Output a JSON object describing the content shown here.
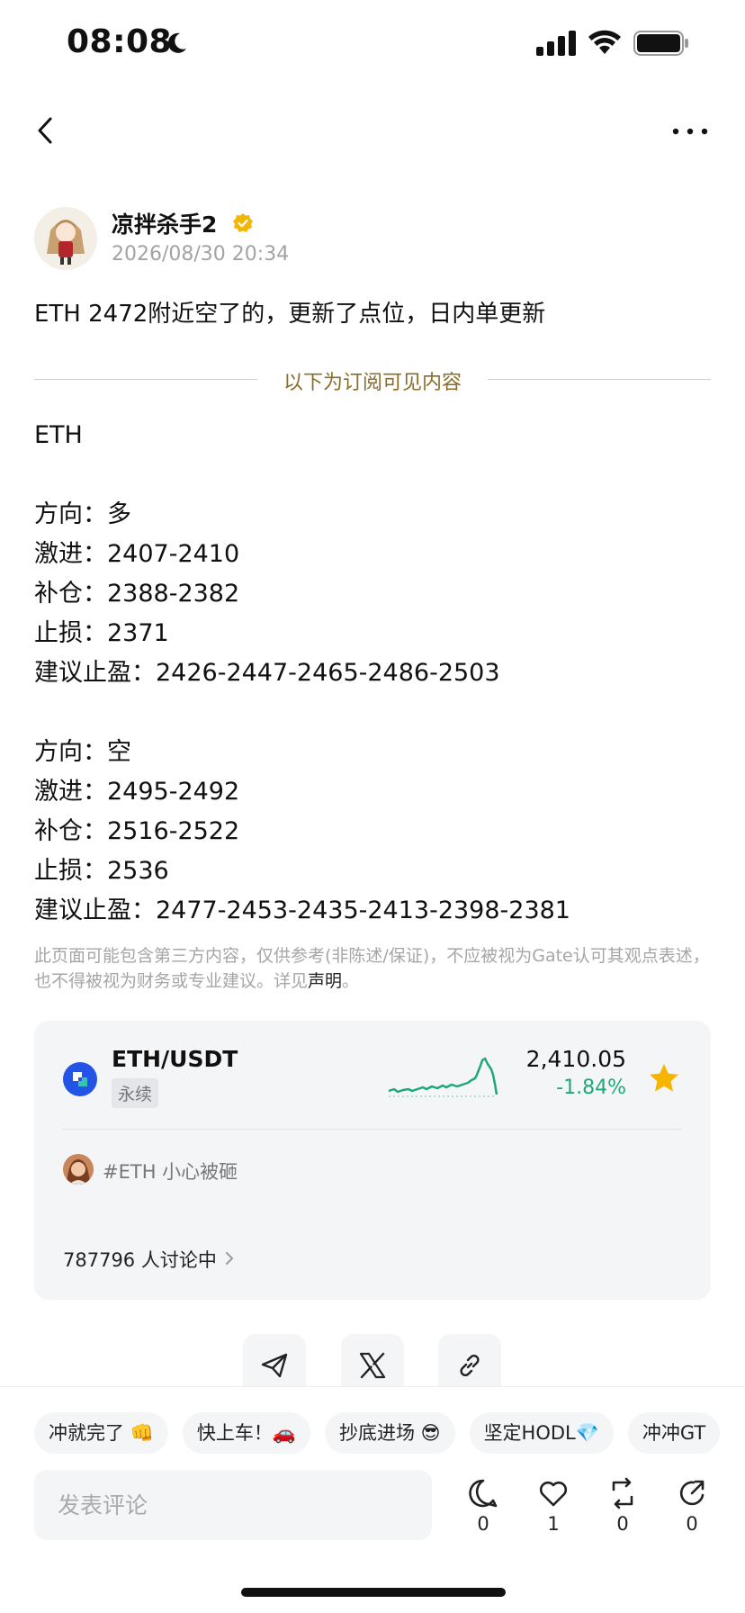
{
  "status_bar": {
    "time": "08:08"
  },
  "nav": {
    "back_icon": "chevron-left-icon",
    "more_icon": "more-horizontal-icon"
  },
  "author": {
    "name": "凉拌杀手2",
    "timestamp": "2026/08/30 20:34",
    "verified": true
  },
  "post": {
    "title": "ETH 2472附近空了的，更新了点位，日内单更新",
    "divider_text": "以下为订阅可见内容",
    "lines": [
      "ETH",
      "",
      "方向：多",
      "激进：2407-2410",
      "补仓：2388-2382",
      "止损：2371",
      "建议止盈：2426-2447-2465-2486-2503",
      "",
      "方向：空",
      "激进：2495-2492",
      "补仓：2516-2522",
      "止损：2536",
      "建议止盈：2477-2453-2435-2413-2398-2381"
    ],
    "disclaimer_text": "此页面可能包含第三方内容，仅供参考(非陈述/保证)，不应被视为Gate认可其观点表述，也不得被视为财务或专业建议。详见",
    "disclaimer_link": "声明",
    "disclaimer_end": "。"
  },
  "market_card": {
    "pair": "ETH/USDT",
    "tag": "永续",
    "price": "2,410.05",
    "change": "-1.84%",
    "change_color": "#1ea87a",
    "favorited": true,
    "topic": "#ETH 小心被砸",
    "discussion": "787796 人讨论中"
  },
  "share": {
    "buttons": [
      "telegram-icon",
      "x-icon",
      "link-icon"
    ]
  },
  "bottom_bar": {
    "chips": [
      "冲就完了 👊",
      "快上车！🚗",
      "抄底进场 😎",
      "坚定HODL💎",
      "冲冲GT"
    ],
    "comment_placeholder": "发表评论",
    "actions": {
      "comment_count": "0",
      "like_count": "1",
      "repost_count": "0",
      "share_count": "0"
    }
  }
}
